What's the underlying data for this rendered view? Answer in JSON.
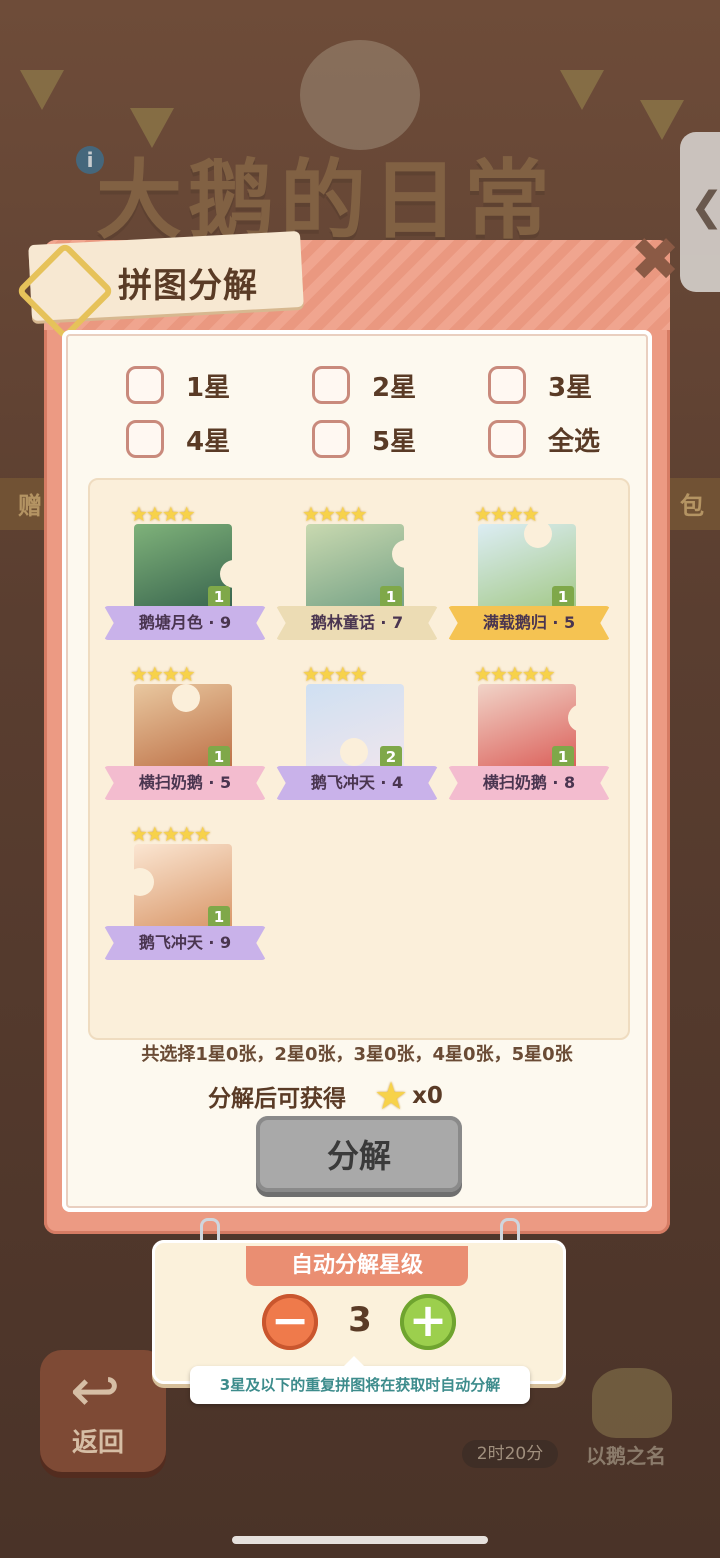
{
  "background": {
    "game_title": "大鹅的日常",
    "info_icon": "i",
    "side_tab_icon": "chevron-left",
    "side_tab_glyph": "❮",
    "bar_left": "赠",
    "bar_right": "包",
    "back_label": "返回",
    "timer": "2时20分",
    "name_label": "以鹅之名"
  },
  "panel": {
    "title": "拼图分解",
    "close_glyph": "✖",
    "filters": [
      {
        "label": "1星",
        "checked": false
      },
      {
        "label": "2星",
        "checked": false
      },
      {
        "label": "3星",
        "checked": false
      },
      {
        "label": "4星",
        "checked": false
      },
      {
        "label": "5星",
        "checked": false
      },
      {
        "label": "全选",
        "checked": false
      }
    ],
    "cards": [
      {
        "stars": "★★★★",
        "count": "1",
        "name": "鹅塘月色 · 9",
        "color": "#4d7a5e"
      },
      {
        "stars": "★★★★",
        "count": "1",
        "name": "鹅林童话 · 7",
        "color": "#9fbfa5"
      },
      {
        "stars": "★★★★",
        "count": "1",
        "name": "满载鹅归 · 5",
        "color": "#b7d9a0"
      },
      {
        "stars": "★★★★",
        "count": "1",
        "name": "横扫奶鹅 · 5",
        "color": "#d69a64"
      },
      {
        "stars": "★★★★",
        "count": "2",
        "name": "鹅飞冲天 · 4",
        "color": "#b7cde6"
      },
      {
        "stars": "★★★★★",
        "count": "1",
        "name": "横扫奶鹅 · 8",
        "color": "#e2625a"
      },
      {
        "stars": "★★★★★",
        "count": "1",
        "name": "鹅飞冲天 · 9",
        "color": "#f0c5a8"
      }
    ],
    "summary": "共选择1星0张，2星0张，3星0张，4星0张，5星0张",
    "gain_label": "分解后可获得",
    "gain_star": "★",
    "gain_amount": "x0",
    "decompose_button": "分解"
  },
  "auto_decompose": {
    "title": "自动分解星级",
    "minus": "−",
    "plus": "+",
    "value": "3",
    "hint": "3星及以下的重复拼图将在获取时自动分解"
  },
  "colors": {
    "panel": "#ec9a83",
    "inner": "#fdf9ef",
    "accent_orange": "#ea8e72",
    "plus_green": "#9ccf4d",
    "minus_orange": "#ef7a4b"
  }
}
